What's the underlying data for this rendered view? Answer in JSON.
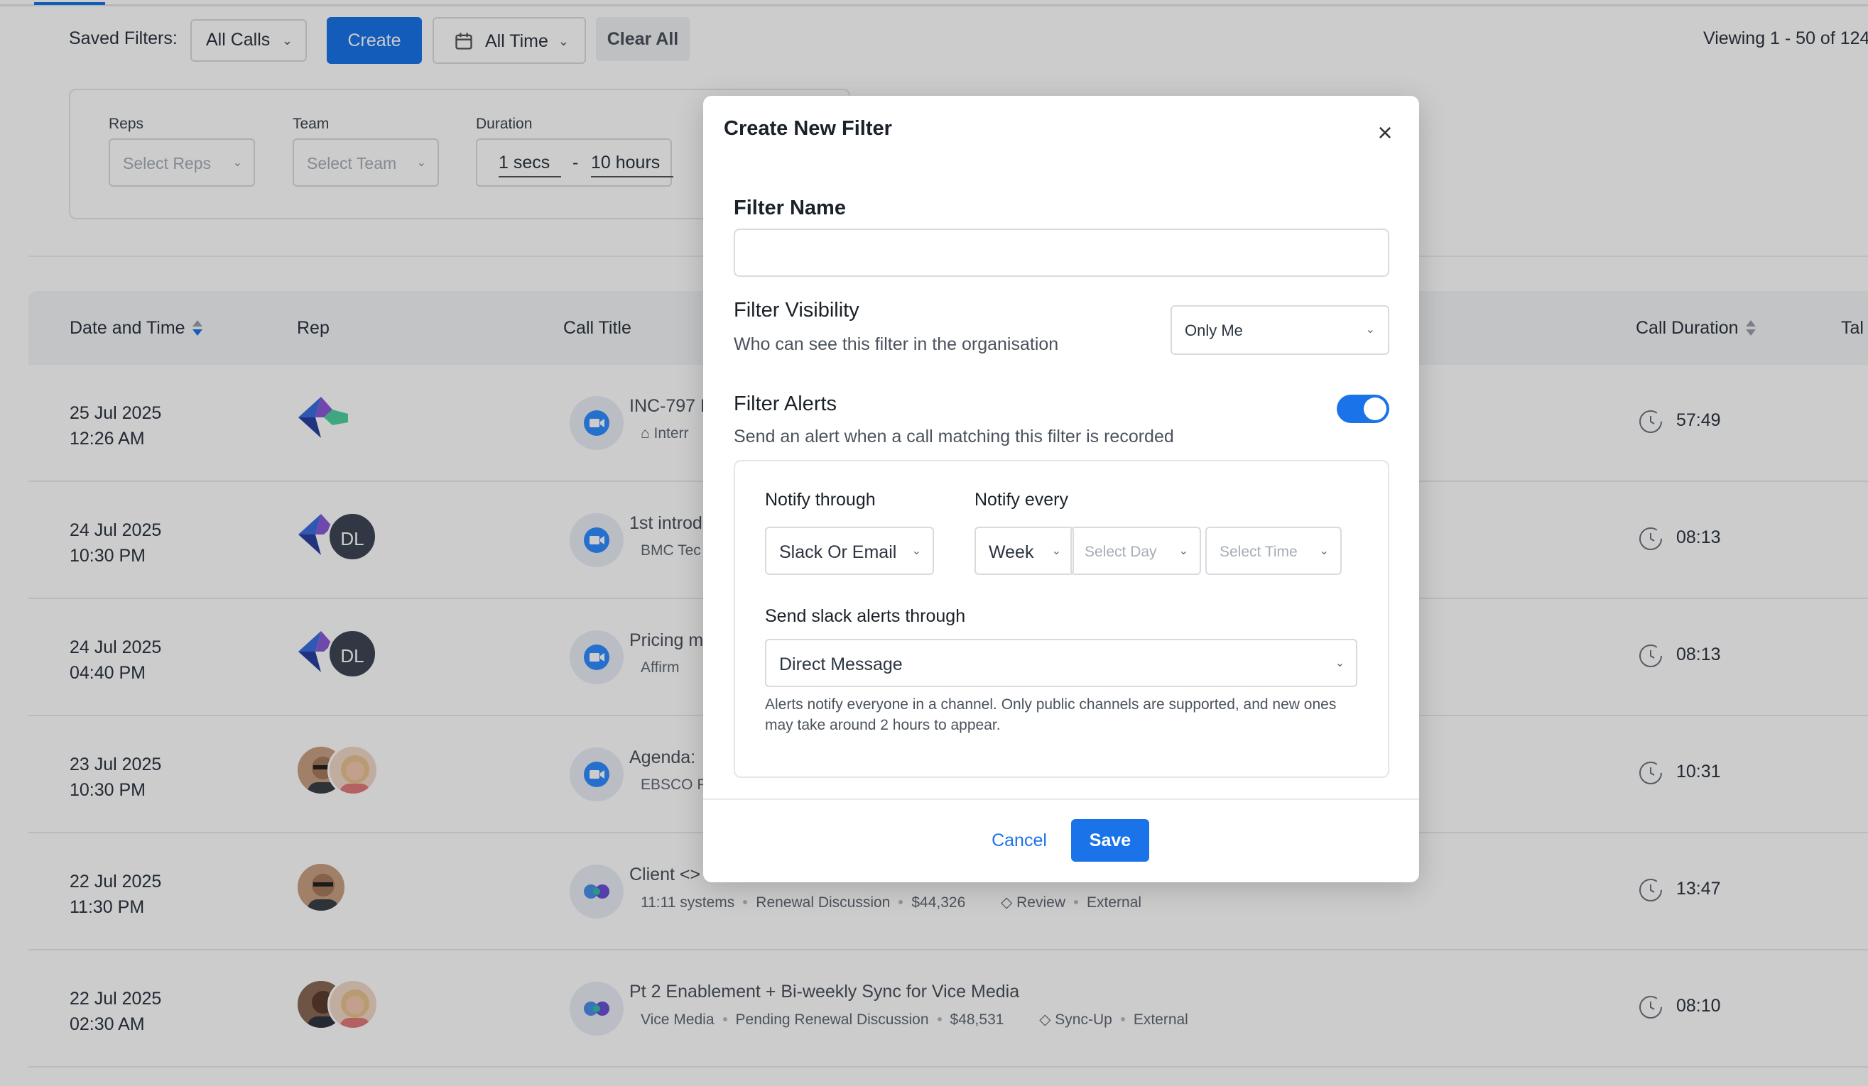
{
  "toolbar": {
    "saved_filters_label": "Saved Filters:",
    "saved_filter_value": "All Calls",
    "create_label": "Create",
    "time_value": "All Time",
    "clear_label": "Clear All",
    "viewing_text": "Viewing 1 - 50 of 124"
  },
  "filters": {
    "reps_label": "Reps",
    "reps_placeholder": "Select Reps",
    "team_label": "Team",
    "team_placeholder": "Select Team",
    "duration_label": "Duration",
    "duration_min": "1 secs",
    "duration_max": "10 hours"
  },
  "table": {
    "columns": [
      "Date and Time",
      "Rep",
      "Call Title",
      "Call Duration",
      "Tal"
    ],
    "rows": [
      {
        "date": "25 Jul 2025",
        "time": "12:26 AM",
        "title": "INC-797 F",
        "meta": [
          "Interr"
        ],
        "duration": "57:49"
      },
      {
        "date": "24 Jul 2025",
        "time": "10:30 PM",
        "avatar": "DL",
        "title": "1st introd",
        "meta": [
          "BMC Tec"
        ],
        "duration": "08:13"
      },
      {
        "date": "24 Jul 2025",
        "time": "04:40 PM",
        "avatar": "DL",
        "title": "Pricing m",
        "meta": [
          "Affirm"
        ],
        "duration": "08:13"
      },
      {
        "date": "23 Jul 2025",
        "time": "10:30 PM",
        "title": "Agenda:",
        "meta": [
          "EBSCO P"
        ],
        "duration": "10:31"
      },
      {
        "date": "22 Jul 2025",
        "time": "11:30 PM",
        "title": "Client <>",
        "meta": [
          "11:11 systems",
          "Renewal Discussion",
          "$44,326"
        ],
        "tags": [
          "Review",
          "External"
        ],
        "duration": "13:47"
      },
      {
        "date": "22 Jul 2025",
        "time": "02:30 AM",
        "title": "Pt 2 Enablement + Bi-weekly Sync for Vice Media",
        "meta": [
          "Vice Media",
          "Pending Renewal Discussion",
          "$48,531"
        ],
        "tags": [
          "Sync-Up",
          "External"
        ],
        "duration": "08:10"
      }
    ]
  },
  "modal": {
    "title": "Create New Filter",
    "close_icon": "×",
    "filter_name_label": "Filter Name",
    "filter_name_value": "",
    "visibility_label": "Filter Visibility",
    "visibility_desc": "Who can see this filter in the organisation",
    "visibility_value": "Only Me",
    "alerts_label": "Filter Alerts",
    "alerts_desc": "Send an alert when a call matching this filter is recorded",
    "alerts_enabled": true,
    "notify_through_label": "Notify through",
    "notify_through_value": "Slack Or Email",
    "notify_every_label": "Notify every",
    "notify_every_value": "Week",
    "day_placeholder": "Select Day",
    "time_placeholder": "Select Time",
    "slack_label": "Send slack alerts through",
    "slack_value": "Direct Message",
    "note": "Alerts notify everyone in a channel. Only public channels are supported, and new ones may take around 2 hours to appear.",
    "cancel_label": "Cancel",
    "save_label": "Save"
  },
  "colors": {
    "accent": "#1a73e8",
    "overlay": "rgba(0,0,0,0.2)"
  }
}
